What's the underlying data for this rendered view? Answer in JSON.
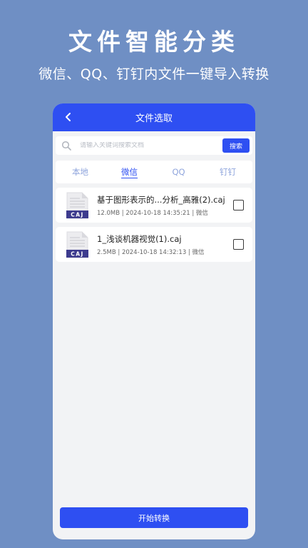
{
  "promo": {
    "headline": "文件智能分类",
    "subline": "微信、QQ、钉钉内文件一键导入转换"
  },
  "screen": {
    "title": "文件选取",
    "search": {
      "placeholder": "请输入关键词搜索文档",
      "button_label": "搜索"
    },
    "tabs": [
      {
        "label": "本地"
      },
      {
        "label": "微信",
        "active": true
      },
      {
        "label": "QQ"
      },
      {
        "label": "钉钉"
      }
    ],
    "files": [
      {
        "icon_label": "CAJ",
        "name": "基于图形表示的...分析_高雅(2).caj",
        "meta": "12.0MB | 2024-10-18 14:35:21 | 微信"
      },
      {
        "icon_label": "CAJ",
        "name": "1_浅谈机器视觉(1).caj",
        "meta": "2.5MB | 2024-10-18 14:32:13 | 微信"
      }
    ],
    "start_button_label": "开始转换"
  },
  "colors": {
    "background": "#6f8fc4",
    "accent": "#2e4ff2",
    "tab_inactive": "#8ea4dc"
  }
}
